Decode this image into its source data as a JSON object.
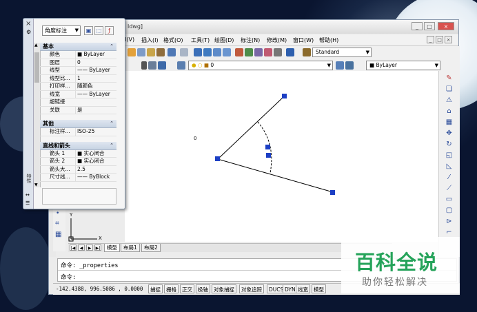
{
  "window": {
    "title": "ldwg]",
    "controls": [
      "_",
      "□",
      "×"
    ]
  },
  "menu": [
    {
      "label": "I(V)"
    },
    {
      "label": "插入(I)"
    },
    {
      "label": "格式(O)"
    },
    {
      "label": "工具(T)"
    },
    {
      "label": "绘图(D)"
    },
    {
      "label": "标注(N)"
    },
    {
      "label": "修改(M)"
    },
    {
      "label": "窗口(W)"
    },
    {
      "label": "帮助(H)"
    }
  ],
  "toolbar": {
    "text_style": "Standard",
    "layer": "0",
    "color_control": "ByLayer"
  },
  "properties_palette": {
    "close_glyph": "×",
    "side_label": "特性",
    "selector": "角度标注",
    "sections": [
      {
        "title": "基本",
        "rows": [
          {
            "key": "颜色",
            "value": "■ ByLayer"
          },
          {
            "key": "图层",
            "value": "0"
          },
          {
            "key": "线型",
            "value": "—— ByLayer"
          },
          {
            "key": "线型比...",
            "value": "1"
          },
          {
            "key": "打印样...",
            "value": "随颜色"
          },
          {
            "key": "线宽",
            "value": "—— ByLayer"
          },
          {
            "key": "超链接",
            "value": ""
          },
          {
            "key": "关联",
            "value": "是"
          }
        ]
      },
      {
        "title": "其他",
        "rows": [
          {
            "key": "标注样...",
            "value": "ISO-25"
          }
        ]
      },
      {
        "title": "直线和箭头",
        "rows": [
          {
            "key": "箭头 1",
            "value": "■ 实心闭合"
          },
          {
            "key": "箭头 2",
            "value": "■ 实心闭合"
          },
          {
            "key": "箭头大...",
            "value": "2.5"
          },
          {
            "key": "尺寸线...",
            "value": "—— ByBlock"
          }
        ]
      }
    ]
  },
  "canvas": {
    "stray_text": "0",
    "ucs_y": "Y",
    "ucs_x": "X"
  },
  "layout_tabs": [
    "模型",
    "布局1",
    "布局2"
  ],
  "command": {
    "history": "命令: _properties",
    "prompt": "命令:"
  },
  "status": {
    "coords": "-142.4388, 996.5086 , 0.0000",
    "buttons": [
      "捕捉",
      "栅格",
      "正交",
      "极轴",
      "对象捕捉",
      "对象追踪",
      "DUCS",
      "DYN",
      "线宽",
      "模型"
    ]
  },
  "watermark": {
    "title": "百科全说",
    "subtitle": "助你轻松解决"
  },
  "colors": {
    "accent": "#2a4b9a",
    "grip": "#1c3fc4",
    "watermark_green": "#25a35a"
  }
}
